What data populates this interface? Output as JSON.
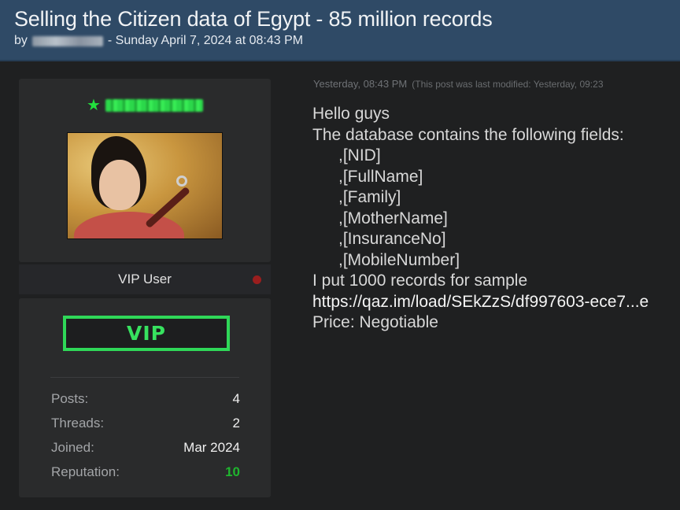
{
  "thread": {
    "title": "Selling the Citizen data of Egypt - 85 million records",
    "by_label": "by",
    "date_text": "- Sunday April 7, 2024 at 08:43 PM"
  },
  "author": {
    "role": "VIP User",
    "badge": "VIP",
    "status_color": "#9a1e1e",
    "stats": [
      {
        "label": "Posts:",
        "value": "4"
      },
      {
        "label": "Threads:",
        "value": "2"
      },
      {
        "label": "Joined:",
        "value": "Mar 2024"
      },
      {
        "label": "Reputation:",
        "value": "10"
      }
    ]
  },
  "post": {
    "timestamp": "Yesterday, 08:43 PM",
    "modified": "(This post was last modified: Yesterday, 09:23",
    "greeting": "Hello guys",
    "intro": "The database contains the following fields:",
    "fields": [
      ",[NID]",
      ",[FullName]",
      ",[Family]",
      ",[MotherName]",
      ",[InsuranceNo]",
      ",[MobileNumber]"
    ],
    "sample": "I put 1000 records for sample",
    "link": "https://qaz.im/load/SEkZzS/df997603-ece7...e",
    "price": "Price: Negotiable"
  },
  "colors": {
    "header_bg": "#2f4a66",
    "page_bg": "#1f2021",
    "vip_green": "#2fd858",
    "reputation_green": "#1fb52e",
    "username_green": "#22e03d"
  }
}
